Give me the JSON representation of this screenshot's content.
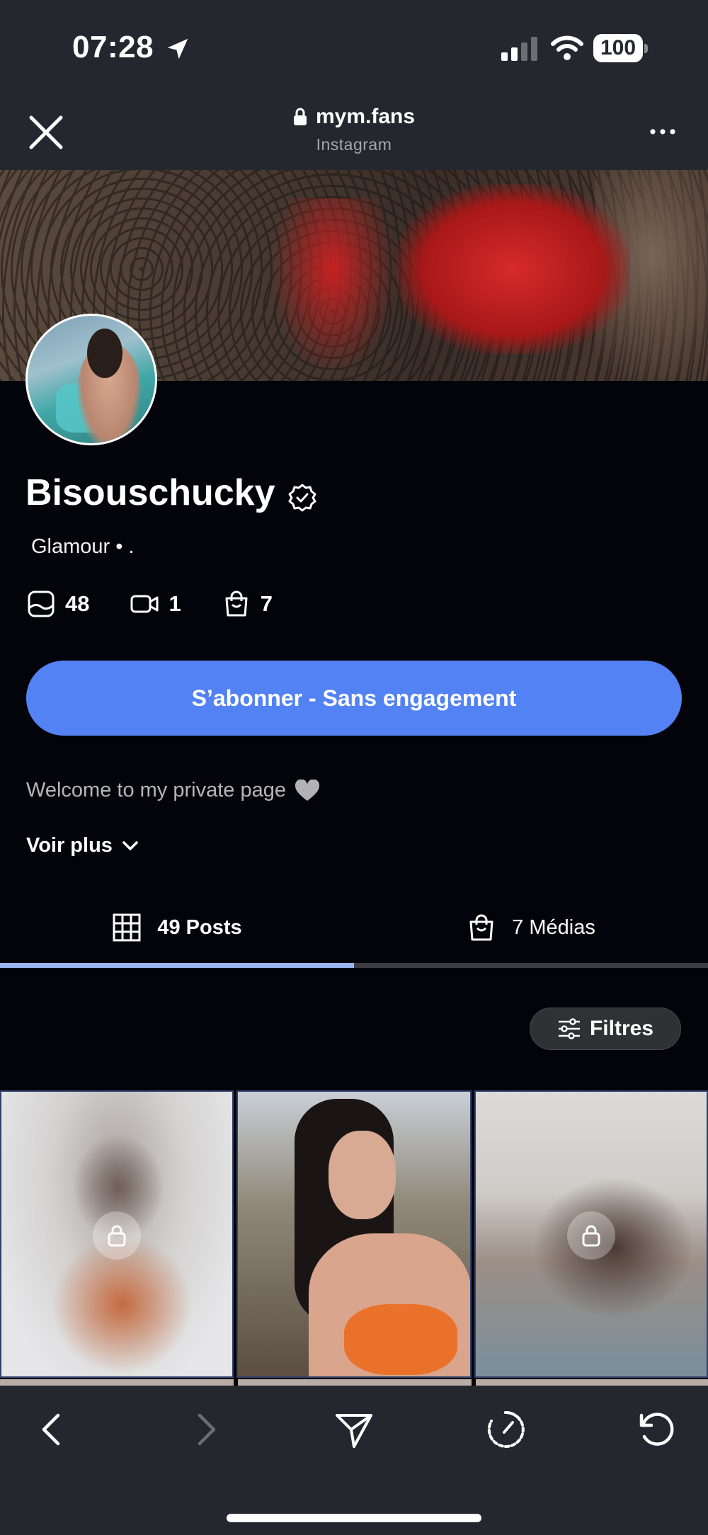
{
  "status_bar": {
    "time": "07:28",
    "battery": "100"
  },
  "browser": {
    "domain": "mym.fans",
    "source": "Instagram"
  },
  "profile": {
    "name": "Bisouschucky",
    "tagline": "Glamour • .",
    "stats": [
      {
        "icon": "image-icon",
        "value": "48"
      },
      {
        "icon": "video-icon",
        "value": "1"
      },
      {
        "icon": "bag-icon",
        "value": "7"
      }
    ],
    "subscribe_label": "S’abonner - Sans engagement",
    "bio": "Welcome to my private page",
    "more_label": "Voir plus"
  },
  "tabs": [
    {
      "label": "49 Posts",
      "icon": "grid-icon",
      "active": true
    },
    {
      "label": "7 Médias",
      "icon": "bag-icon",
      "active": false
    }
  ],
  "filters_label": "Filtres",
  "posts": [
    {
      "locked": true
    },
    {
      "locked": false
    },
    {
      "locked": true
    }
  ],
  "colors": {
    "accent": "#5382f4",
    "background": "#03040a",
    "chrome": "#24272e"
  }
}
